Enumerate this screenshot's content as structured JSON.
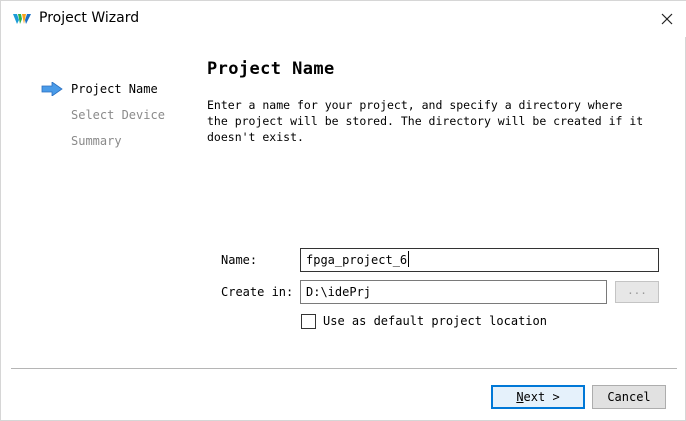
{
  "window": {
    "title": "Project Wizard",
    "close_glyph": "×"
  },
  "steps": [
    {
      "label": "Project Name",
      "active": true
    },
    {
      "label": "Select Device",
      "active": false
    },
    {
      "label": "Summary",
      "active": false
    }
  ],
  "page": {
    "heading": "Project Name",
    "description": "Enter a name for your project, and specify a directory where\nthe project will be stored. The directory will be created if it\ndoesn't exist."
  },
  "form": {
    "name_label": "Name:",
    "name_value": "fpga_project_6",
    "create_in_label": "Create in:",
    "create_in_value": "D:\\idePrj",
    "browse_label": "...",
    "default_location_label": "Use as default project location",
    "default_location_checked": false
  },
  "footer": {
    "next_mnemonic": "N",
    "next_rest": "ext >",
    "cancel_label": "Cancel"
  },
  "colors": {
    "accent": "#0078d7",
    "step_arrow": "#3a8ee6",
    "inactive_text": "#8a8a8a"
  }
}
